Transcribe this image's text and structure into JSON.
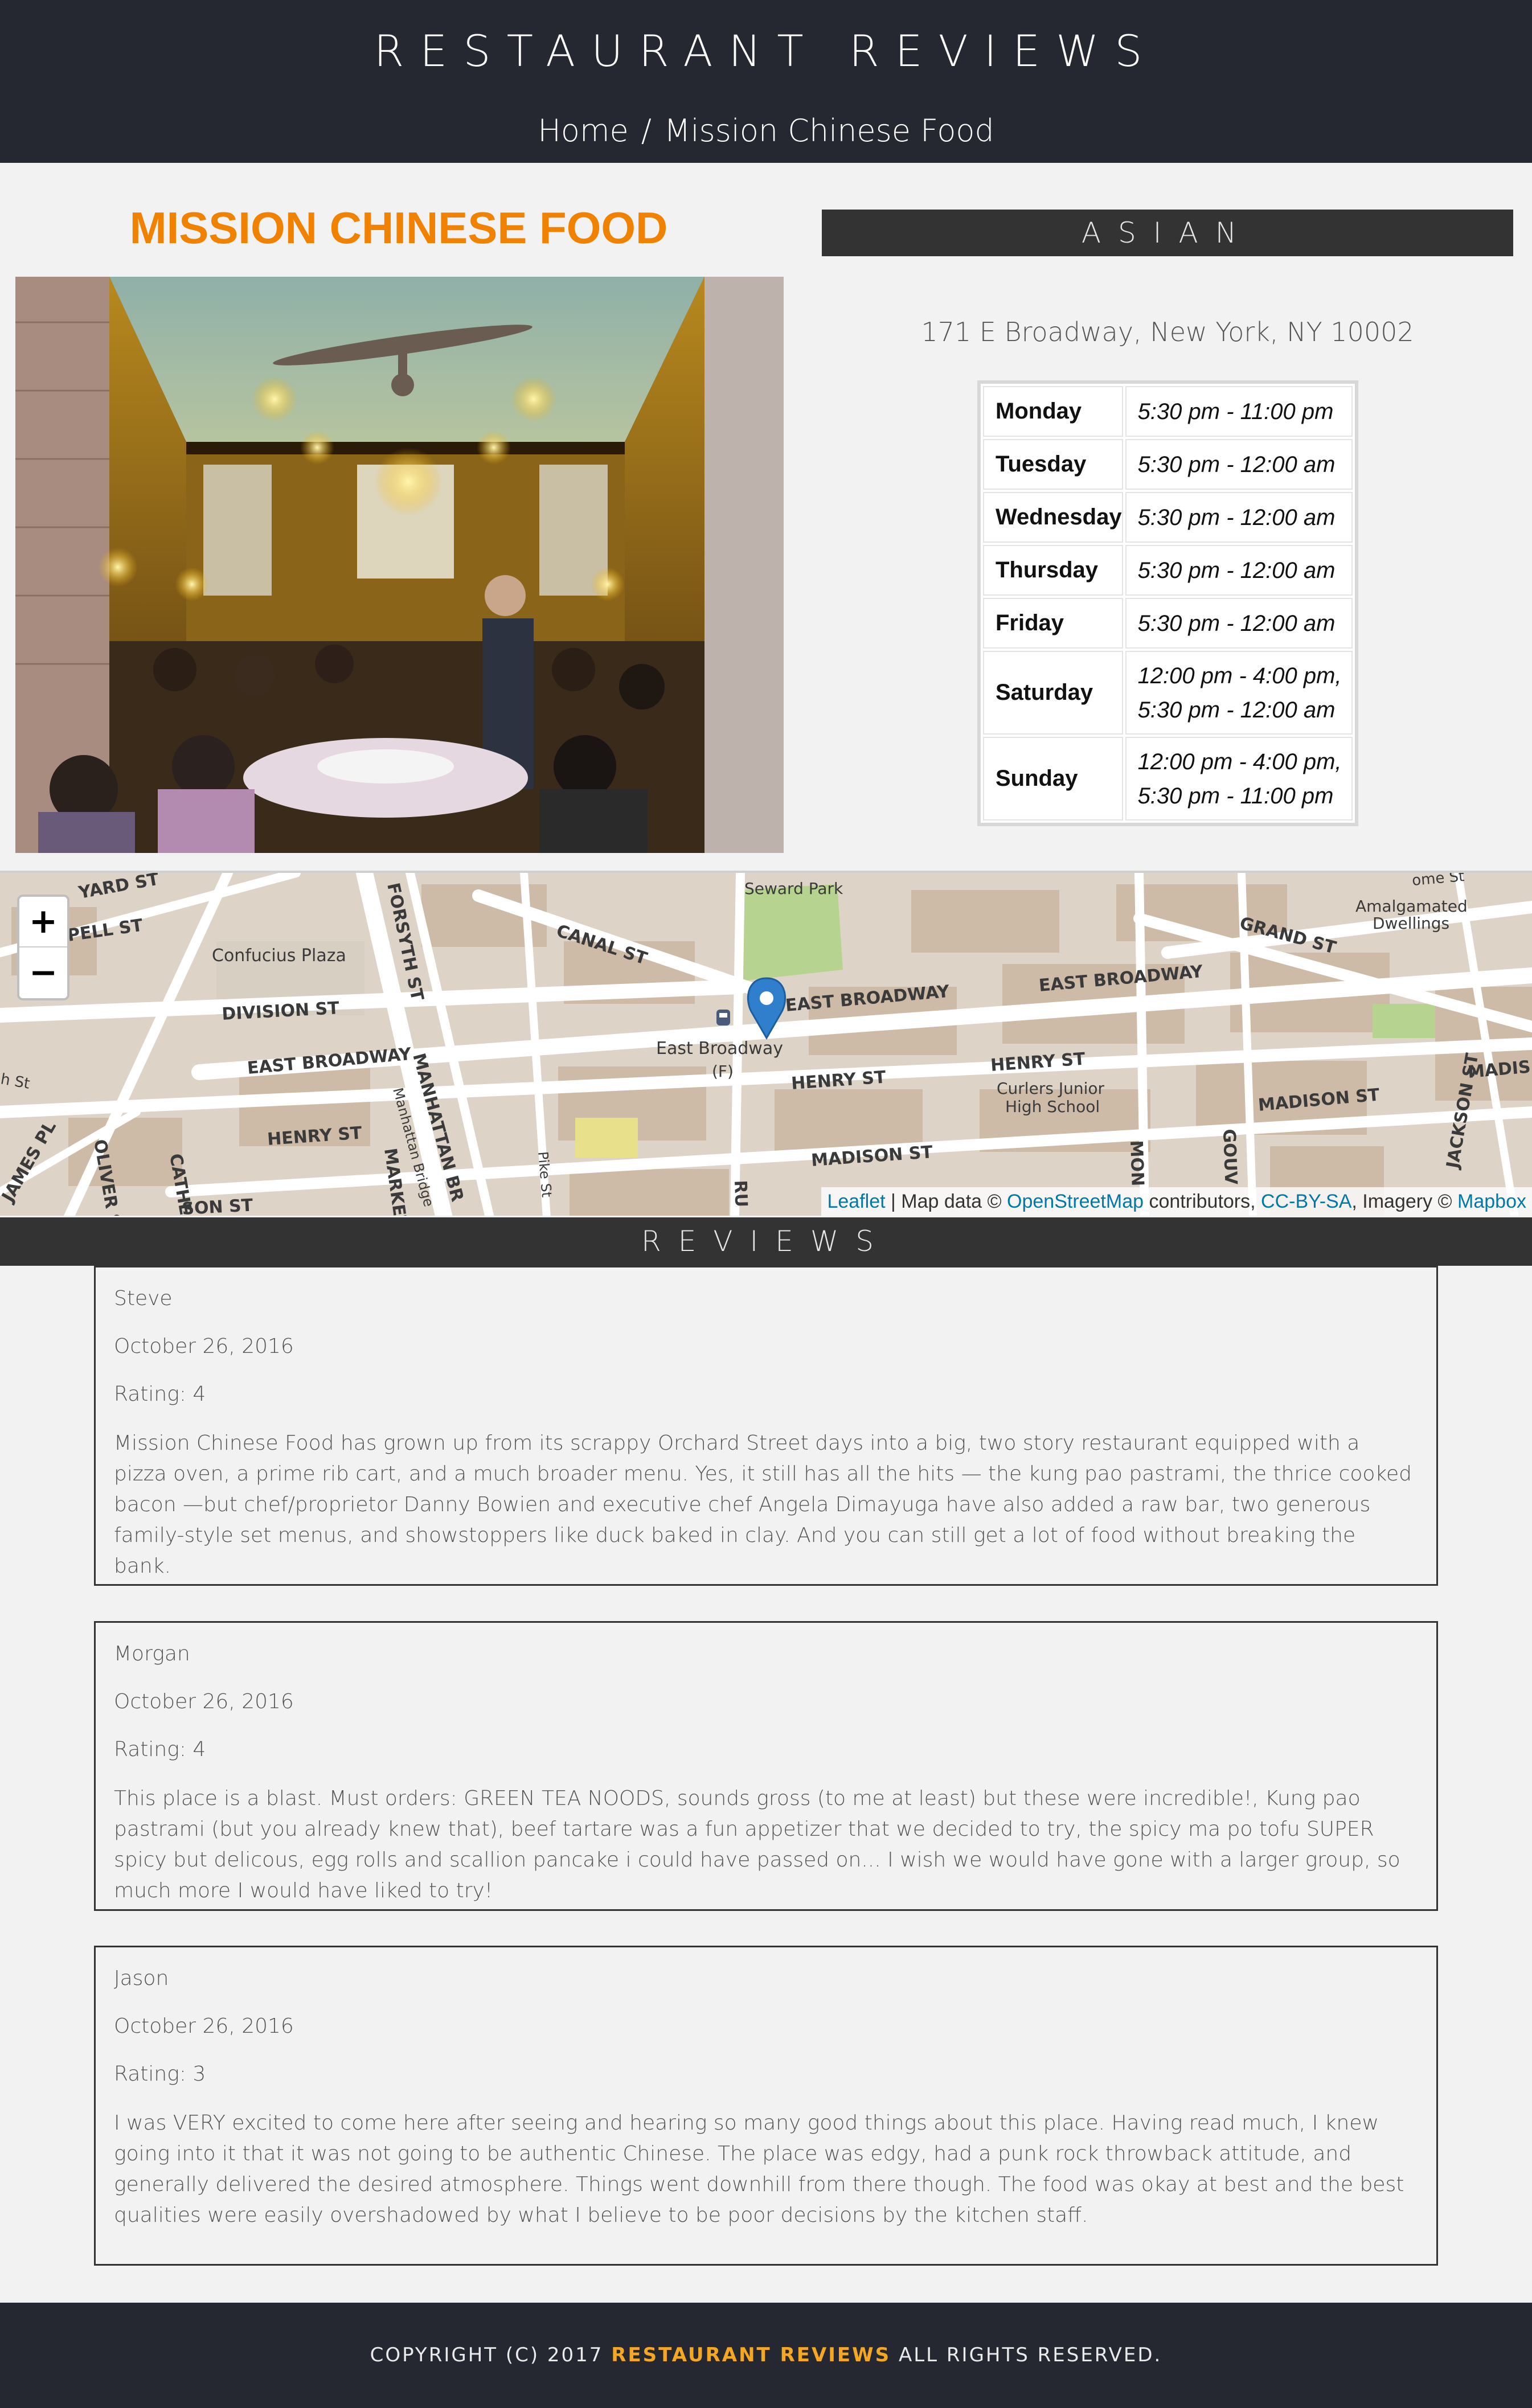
{
  "header": {
    "title": "RESTAURANT REVIEWS",
    "breadcrumb": {
      "home": "Home",
      "separator": "/",
      "current": "Mission Chinese Food"
    }
  },
  "restaurant": {
    "name": "MISSION CHINESE FOOD",
    "image_alt": "Mission Chinese Food dining room",
    "cuisine": "ASIAN",
    "address": "171 E Broadway, New York, NY 10002",
    "hours": [
      {
        "day": "Monday",
        "time": "5:30 pm - 11:00 pm"
      },
      {
        "day": "Tuesday",
        "time": "5:30 pm - 12:00 am"
      },
      {
        "day": "Wednesday",
        "time": "5:30 pm - 12:00 am"
      },
      {
        "day": "Thursday",
        "time": "5:30 pm - 12:00 am"
      },
      {
        "day": "Friday",
        "time": "5:30 pm - 12:00 am"
      },
      {
        "day": "Saturday",
        "time": "12:00 pm - 4:00 pm, 5:30 pm - 12:00 am"
      },
      {
        "day": "Sunday",
        "time": "12:00 pm - 4:00 pm, 5:30 pm - 11:00 pm"
      }
    ]
  },
  "map": {
    "zoom_in": "+",
    "zoom_out": "−",
    "labels": {
      "seward_park": "Seward Park",
      "amalgamated": "Amalgamated",
      "dwellings": "Dwellings",
      "confucius_plaza": "Confucius Plaza",
      "canal_st": "CANAL ST",
      "forsyth_st": "FORSYTH ST",
      "division_st": "DIVISION ST",
      "east_broadway_main": "EAST BROADWAY",
      "east_broadway_mid": "EAST BROADWAY",
      "east_broadway_left": "EAST BROADWAY",
      "grand_st": "GRAND ST",
      "henry_st_mid": "HENRY ST",
      "henry_st_right": "HENRY ST",
      "henry_st_left": "HENRY ST",
      "madison_st_mid": "MADISON ST",
      "madison_st_right": "MADISON ST",
      "madison_edge": "MADIS",
      "jackson_st": "JACKSON ST",
      "pell_st": "PELL ST",
      "yard_st": "YARD ST",
      "station": "East Broadway",
      "station_line": "(F)",
      "curlers_1": "Curlers Junior",
      "curlers_2": "High School",
      "manhattan_br": "MANHATTAN BR",
      "manhattan_bridge": "Manhattan Bridge",
      "market": "MARKET",
      "pike_st": "Pike St",
      "oliver_st": "OLIVER ST",
      "catherine": "CATHE",
      "james_pl": "JAMES PL",
      "rut": "RU",
      "mon": "MON",
      "gouv": "GOUV",
      "some_st": "ome St",
      "son_st": "SON ST",
      "st_left": "h St"
    },
    "attribution": {
      "leaflet": "Leaflet",
      "sep": " | Map data © ",
      "osm": "OpenStreetMap",
      "contributors": " contributors, ",
      "license": "CC-BY-SA",
      "imagery": ", Imagery © ",
      "mapbox": "Mapbox"
    },
    "colors": {
      "land": "#ddd3c6",
      "block": "#cfbfae",
      "road": "#ffffff",
      "park": "#b6d48f",
      "marker": "#2f7fcc"
    }
  },
  "reviews_title": "REVIEWS",
  "reviews": [
    {
      "name": "Steve",
      "date": "October 26, 2016",
      "rating": "Rating: 4",
      "comments": "Mission Chinese Food has grown up from its scrappy Orchard Street days into a big, two story restaurant equipped with a pizza oven, a prime rib cart, and a much broader menu. Yes, it still has all the hits — the kung pao pastrami, the thrice cooked bacon —but chef/proprietor Danny Bowien and executive chef Angela Dimayuga have also added a raw bar, two generous family-style set menus, and showstoppers like duck baked in clay. And you can still get a lot of food without breaking the bank."
    },
    {
      "name": "Morgan",
      "date": "October 26, 2016",
      "rating": "Rating: 4",
      "comments": "This place is a blast. Must orders: GREEN TEA NOODS, sounds gross (to me at least) but these were incredible!, Kung pao pastrami (but you already knew that), beef tartare was a fun appetizer that we decided to try, the spicy ma po tofu SUPER spicy but delicous, egg rolls and scallion pancake i could have passed on... I wish we would have gone with a larger group, so much more I would have liked to try!"
    },
    {
      "name": "Jason",
      "date": "October 26, 2016",
      "rating": "Rating: 3",
      "comments": "I was VERY excited to come here after seeing and hearing so many good things about this place. Having read much, I knew going into it that it was not going to be authentic Chinese. The place was edgy, had a punk rock throwback attitude, and generally delivered the desired atmosphere. Things went downhill from there though. The food was okay at best and the best qualities were easily overshadowed by what I believe to be poor decisions by the kitchen staff."
    }
  ],
  "footer": {
    "prefix": "COPYRIGHT (C) 2017 ",
    "brand": "RESTAURANT REVIEWS",
    "suffix": " ALL RIGHTS RESERVED.",
    "brand_color": "#f5a623"
  }
}
